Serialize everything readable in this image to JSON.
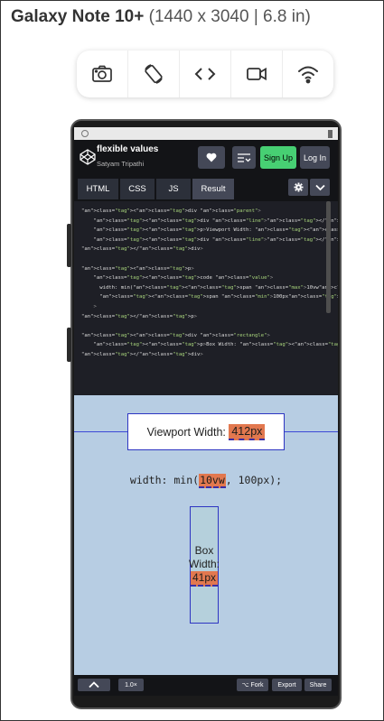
{
  "device": {
    "name": "Galaxy Note 10+",
    "dims": "(1440 x 3040 | 6.8 in)"
  },
  "toolbar": {
    "icons": [
      "camera-icon",
      "rotate-icon",
      "code-icon",
      "video-icon",
      "wifi-icon"
    ]
  },
  "codepen": {
    "title": "flexible values",
    "author": "Satyam Tripathi",
    "signup_label": "Sign Up",
    "login_label": "Log In",
    "tabs": [
      "HTML",
      "CSS",
      "JS",
      "Result"
    ],
    "active_tab": "Result"
  },
  "code_lines": [
    "<div class=\"parent\">",
    "    <div class=\"line\"></div>",
    "    <p>Viewport Width: <span class=\"viewport\"></span></p>",
    "    <div class=\"line\"></div>",
    "</div>",
    "",
    "<p>",
    "    <code class=\"value\">",
    "      width: min(<span class=\"max\">10vw</span>,",
    "      <span class=\"min\">100px</span>);</code",
    "    >",
    "</p>",
    "",
    "<div class=\"rectangle\">",
    "    <p>Box Width: <span class=\"box\"></span></p>",
    "</div>"
  ],
  "result": {
    "viewport_label": "Viewport Width:",
    "viewport_value": "412px",
    "value_prefix": "width: min(",
    "value_max": "10vw",
    "value_suffix": ", 100px);",
    "box_label_1": "Box",
    "box_label_2": "Width:",
    "box_value": "41px"
  },
  "bottombar": {
    "zoom": "1.0×",
    "fork": "⌥ Fork",
    "export": "Export",
    "share": "Share"
  },
  "colors": {
    "result_bg": "#b7cde3",
    "highlight": "#e2784f",
    "signup": "#47cf73",
    "border_blue": "#2e35c2"
  }
}
